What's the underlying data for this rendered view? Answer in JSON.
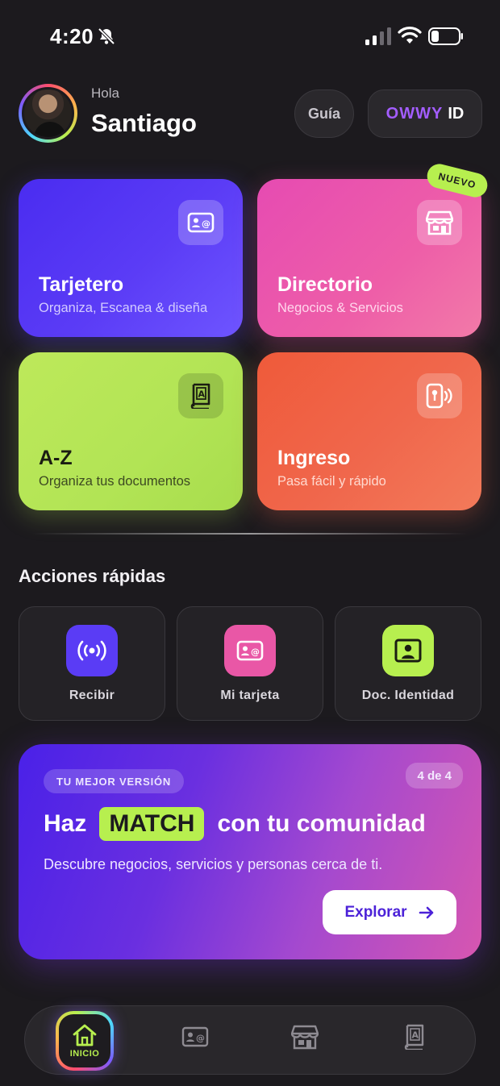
{
  "status_bar": {
    "time": "4:20"
  },
  "header": {
    "greeting": "Hola",
    "username": "Santiago",
    "guide_label": "Guía",
    "brand_label": "OWWY",
    "id_label": "ID"
  },
  "cards": [
    {
      "title": "Tarjetero",
      "subtitle": "Organiza, Escanea & diseña",
      "icon": "contact-card-icon",
      "color": "#5236f3"
    },
    {
      "title": "Directorio",
      "subtitle": "Negocios & Servicios",
      "icon": "store-icon",
      "color": "#ea55ac",
      "badge": "NUEVO"
    },
    {
      "title": "A-Z",
      "subtitle": "Organiza tus documentos",
      "icon": "document-book-icon",
      "color": "#b4e656"
    },
    {
      "title": "Ingreso",
      "subtitle": "Pasa fácil y rápido",
      "icon": "access-key-icon",
      "color": "#f06246"
    }
  ],
  "quick_actions": {
    "title": "Acciones rápidas",
    "items": [
      {
        "label": "Recibir",
        "icon": "broadcast-icon",
        "color": "#5a3cf5"
      },
      {
        "label": "Mi tarjeta",
        "icon": "contact-card-icon",
        "color": "#e957a6"
      },
      {
        "label": "Doc. Identidad",
        "icon": "id-photo-icon",
        "color": "#b7ef4f"
      }
    ]
  },
  "promo": {
    "tag": "TU MEJOR VERSIÓN",
    "counter": "4 de 4",
    "headline_before": "Haz",
    "headline_highlight": "MATCH",
    "headline_after": "con tu comunidad",
    "description": "Descubre negocios, servicios y personas cerca de ti.",
    "button_label": "Explorar"
  },
  "bottom_nav": {
    "items": [
      {
        "label": "INICIO",
        "icon": "home-icon",
        "active": true
      },
      {
        "icon": "contact-card-icon"
      },
      {
        "icon": "store-icon"
      },
      {
        "icon": "document-book-icon"
      }
    ]
  },
  "colors": {
    "background": "#1c1a1e",
    "accent_lime": "#b7ef4f",
    "accent_purple": "#5236f3",
    "brand_purple": "#a35dff"
  }
}
